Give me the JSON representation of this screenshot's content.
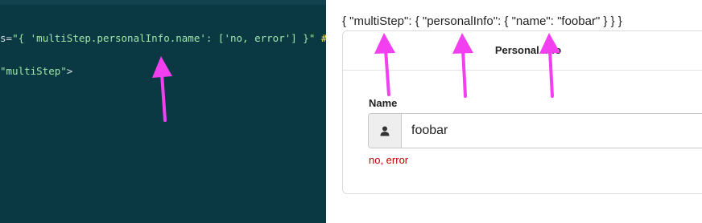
{
  "editor": {
    "line1": {
      "attr_tail": "s=",
      "value": "\"{ 'multiStep.personalInfo.name': ['no, error'] }\"",
      "hash": " #"
    },
    "line2": {
      "value": "\"multiStep\"",
      "close": ">"
    }
  },
  "preview": {
    "json_output": "{ \"multiStep\": { \"personalInfo\": { \"name\": \"foobar\" } } }",
    "card_title": "Personal Info",
    "name_label": "Name",
    "name_value": "foobar",
    "error_text": "no, error"
  },
  "icons": {
    "input_addon": "user-icon"
  },
  "colors": {
    "editor_bg": "#0a3843",
    "code_string": "#9ee6a8",
    "annotation_arrow": "#f23ff0",
    "error": "#c00000"
  }
}
